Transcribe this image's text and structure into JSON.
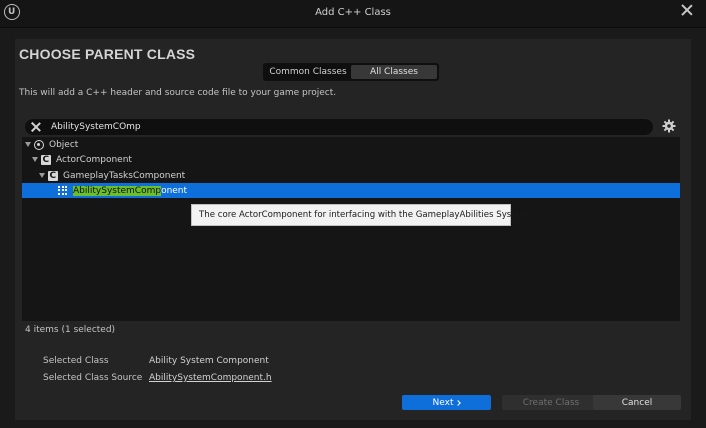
{
  "window": {
    "title": "Add C++ Class",
    "logo_icon": "unreal-logo-icon",
    "close_icon": "close-icon"
  },
  "heading": "CHOOSE PARENT CLASS",
  "tabs": [
    {
      "label": "Common Classes",
      "active": false
    },
    {
      "label": "All Classes",
      "active": true
    }
  ],
  "description": "This will add a C++ header and source code file to your game project.",
  "search": {
    "value": "AbilitySystemCOmp",
    "clear_icon": "clear-search-icon",
    "settings_icon": "gear-icon"
  },
  "tree": [
    {
      "label": "Object",
      "icon": "object-icon",
      "level": 0,
      "expanded": true,
      "selected": false
    },
    {
      "label": "ActorComponent",
      "icon": "cpp-class-icon",
      "level": 1,
      "expanded": true,
      "selected": false
    },
    {
      "label": "GameplayTasksComponent",
      "icon": "cpp-class-icon",
      "level": 2,
      "expanded": true,
      "selected": false
    },
    {
      "label_highlight": "AbilitySystemComp",
      "label_rest": "onent",
      "icon": "component-icon",
      "level": 3,
      "expanded": false,
      "selected": true
    }
  ],
  "tooltip": "The core ActorComponent for interfacing with the GameplayAbilities System",
  "status": "4 items (1 selected)",
  "info": {
    "selected_class_label": "Selected Class",
    "selected_class_value": "Ability System Component",
    "selected_source_label": "Selected Class Source",
    "selected_source_value": "AbilitySystemComponent.h"
  },
  "buttons": {
    "next": "Next",
    "create": "Create Class",
    "cancel": "Cancel"
  },
  "colors": {
    "accent": "#0e6fdb",
    "highlight": "#6bbf2c",
    "panel": "#242424",
    "background": "#1a1a1a"
  }
}
